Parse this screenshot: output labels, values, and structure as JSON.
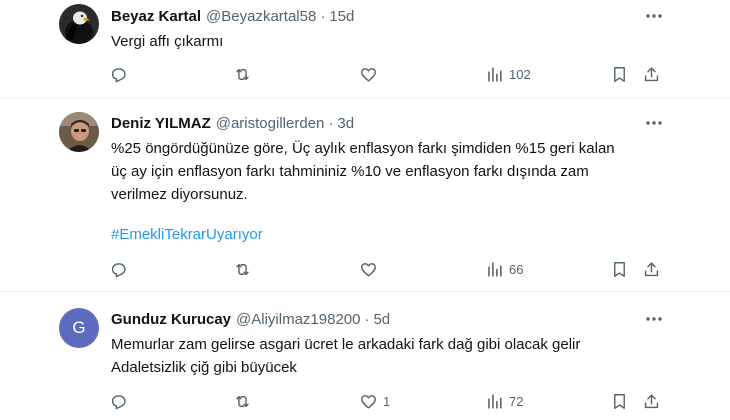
{
  "tweets": [
    {
      "name": "Beyaz Kartal",
      "handle": "@Beyazkartal58",
      "separator": "·",
      "time": "15d",
      "lines": [
        "Vergi affı çıkarmı"
      ],
      "hashtag": "",
      "reply_count": "",
      "retweet_count": "",
      "like_count": "",
      "view_count": "102",
      "avatar_letter": ""
    },
    {
      "name": "Deniz YILMAZ",
      "handle": "@aristogillerden",
      "separator": "·",
      "time": "3d",
      "lines": [
        "%25 öngördüğünüze göre, Üç aylık enflasyon farkı şimdiden %15 geri kalan",
        "üç ay için enflasyon farkı tahmininiz %10 ve enflasyon farkı dışında zam",
        "verilmez diyorsunuz."
      ],
      "hashtag": "#EmekliTekrarUyarıyor",
      "reply_count": "",
      "retweet_count": "",
      "like_count": "",
      "view_count": "66",
      "avatar_letter": ""
    },
    {
      "name": "Gunduz Kurucay",
      "handle": "@Aliyilmaz198200",
      "separator": "·",
      "time": "5d",
      "lines": [
        "Memurlar zam gelirse asgari ücret le arkadaki fark dağ gibi olacak gelir",
        "Adaletsizlik çiğ gibi büyücek"
      ],
      "hashtag": "",
      "reply_count": "",
      "retweet_count": "",
      "like_count": "1",
      "view_count": "72",
      "avatar_letter": "G"
    }
  ],
  "colors": {
    "text": "#0f1419",
    "secondary": "#536471",
    "link": "#1d9bf0",
    "divider": "#eff3f4",
    "avatar_g": "#5c6bc0"
  }
}
